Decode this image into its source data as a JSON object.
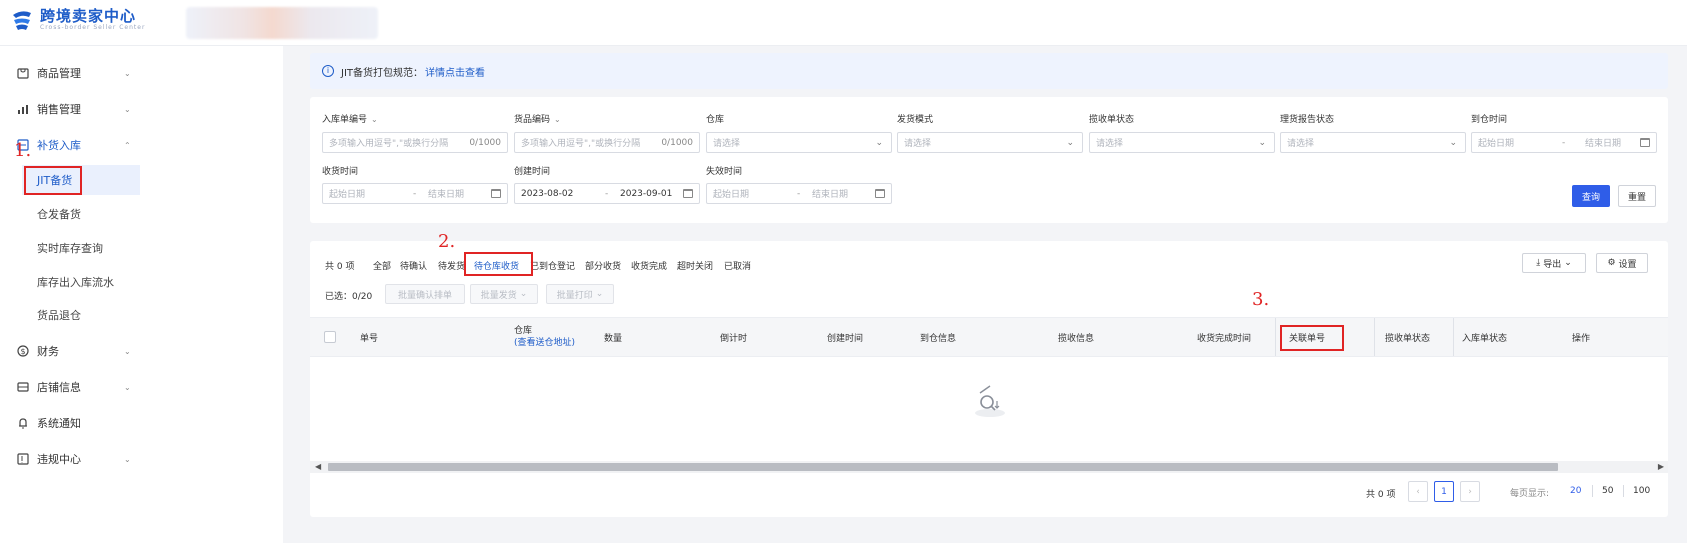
{
  "app": {
    "title": "跨境卖家中心",
    "subtitle": "Cross-border Seller Center"
  },
  "sidebar": {
    "items": [
      {
        "label": "商品管理",
        "icon": "box-icon"
      },
      {
        "label": "销售管理",
        "icon": "chart-icon"
      },
      {
        "label": "补货入库",
        "icon": "inbound-icon"
      },
      {
        "label": "财务",
        "icon": "dollar-icon"
      },
      {
        "label": "店铺信息",
        "icon": "store-icon"
      },
      {
        "label": "系统通知",
        "icon": "bell-icon"
      },
      {
        "label": "违规中心",
        "icon": "warning-icon"
      }
    ],
    "subitems": [
      "JIT备货",
      "仓发备货",
      "实时库存查询",
      "库存出入库流水",
      "货品退仓"
    ],
    "active_subitem": "JIT备货"
  },
  "annotations": {
    "n1": "1.",
    "n2": "2.",
    "n3": "3."
  },
  "notice": {
    "text": "JIT备货打包规范：",
    "link": "详情点击查看"
  },
  "filters": {
    "inbound_no": {
      "label": "入库单编号",
      "placeholder": "多项输入用逗号\",\"或换行分隔",
      "count": "0/1000"
    },
    "goods_code": {
      "label": "货品编码",
      "placeholder": "多项输入用逗号\",\"或换行分隔",
      "count": "0/1000"
    },
    "warehouse": {
      "label": "仓库",
      "placeholder": "请选择"
    },
    "ship_mode": {
      "label": "发货模式",
      "placeholder": "请选择"
    },
    "receipt_status": {
      "label": "揽收单状态",
      "placeholder": "请选择"
    },
    "report_status": {
      "label": "理货报告状态",
      "placeholder": "请选择"
    },
    "arrival_time": {
      "label": "到仓时间",
      "start": "起始日期",
      "sep": "-",
      "end": "结束日期"
    },
    "received_time": {
      "label": "收货时间",
      "start": "起始日期",
      "sep": "-",
      "end": "结束日期"
    },
    "created_time": {
      "label": "创建时间",
      "start": "2023-08-02",
      "sep": "-",
      "end": "2023-09-01"
    },
    "expire_time": {
      "label": "失效时间",
      "start": "起始日期",
      "sep": "-",
      "end": "结束日期"
    },
    "query_label": "查询",
    "reset_label": "重置"
  },
  "tabs": {
    "total": "共 0 项",
    "items": [
      "全部",
      "待确认",
      "待发货",
      "待仓库收货",
      "已到仓登记",
      "部分收货",
      "收货完成",
      "超时关闭",
      "已取消"
    ],
    "active": "待仓库收货"
  },
  "actions": {
    "selected": "已选：0/20",
    "batch_confirm": "批量确认排单",
    "batch_ship": "批量发货",
    "batch_print": "批量打印",
    "export": "导出",
    "settings": "设置"
  },
  "table": {
    "columns": [
      "单号",
      "仓库",
      "数量",
      "倒计时",
      "创建时间",
      "到仓信息",
      "揽收信息",
      "收货完成时间",
      "关联单号",
      "揽收单状态",
      "入库单状态",
      "操作"
    ],
    "warehouse_link": "(查看送仓地址)"
  },
  "pagination": {
    "total": "共 0 项",
    "current": "1",
    "per_page_label": "每页显示:",
    "sizes": [
      "20",
      "50",
      "100"
    ],
    "active_size": "20"
  }
}
